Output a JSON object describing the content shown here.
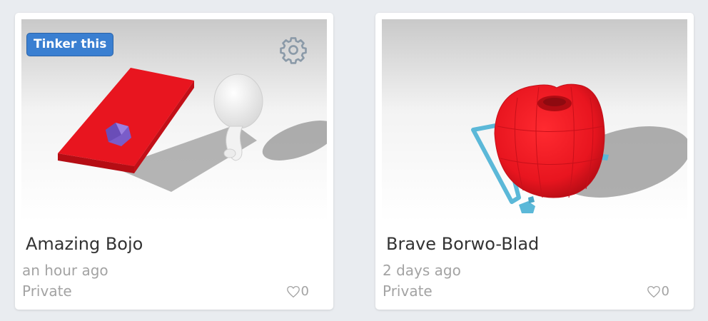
{
  "designs": [
    {
      "title": "Amazing Bojo",
      "time": "an hour ago",
      "privacy": "Private",
      "likes": "0",
      "tinker_label": "Tinker this"
    },
    {
      "title": "Brave Borwo-Blad",
      "time": "2 days ago",
      "privacy": "Private",
      "likes": "0"
    }
  ],
  "colors": {
    "accent_button": "#3a7fd1",
    "model_red": "#e8151f",
    "model_purple": "#7a5cc9",
    "model_teal": "#5bb8d8",
    "muted_text": "#a3a3a3"
  },
  "icons": [
    "gear-icon",
    "heart-icon"
  ]
}
